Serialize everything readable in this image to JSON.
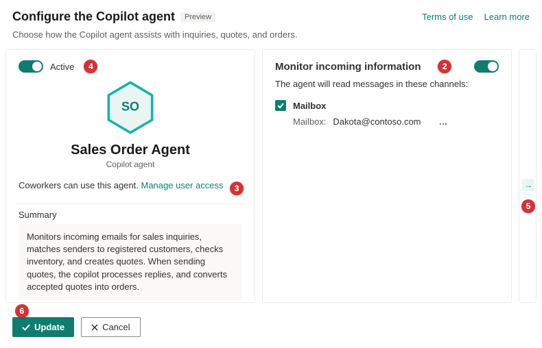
{
  "header": {
    "title": "Configure the Copilot agent",
    "preview_badge": "Preview",
    "links": {
      "terms": "Terms of use",
      "learn": "Learn more"
    }
  },
  "subhead": "Choose how the Copilot agent assists with inquiries, quotes, and orders.",
  "left_card": {
    "active_label": "Active",
    "hex_initials": "SO",
    "agent_name": "Sales Order Agent",
    "agent_sub": "Copilot agent",
    "access_text": "Coworkers can use this agent.",
    "access_link": "Manage user access",
    "summary_title": "Summary",
    "summary_body": "Monitors incoming emails for sales inquiries, matches senders to registered customers, checks inventory, and creates quotes. When sending quotes, the copilot processes replies, and converts accepted quotes into orders."
  },
  "right_card": {
    "title": "Monitor incoming information",
    "sub": "The agent will read messages in these channels:",
    "channel": {
      "name": "Mailbox",
      "field_label": "Mailbox:",
      "value": "Dakota@contoso.com"
    }
  },
  "footer": {
    "update": "Update",
    "cancel": "Cancel"
  },
  "markers": {
    "m2": "2",
    "m3": "3",
    "m4": "4",
    "m5": "5",
    "m6": "6"
  }
}
